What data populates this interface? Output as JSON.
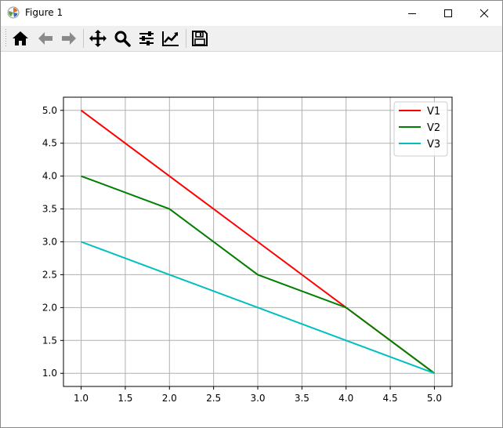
{
  "window": {
    "title": "Figure 1",
    "app_icon": "matplotlib-icon",
    "controls": [
      "minimize-icon",
      "maximize-icon",
      "close-icon"
    ]
  },
  "toolbar": {
    "buttons": [
      {
        "name": "home",
        "icon": "home-icon"
      },
      {
        "name": "back",
        "icon": "arrow-left-icon"
      },
      {
        "name": "forward",
        "icon": "arrow-right-icon"
      },
      {
        "name": "pan",
        "icon": "move-icon"
      },
      {
        "name": "zoom",
        "icon": "magnifier-icon"
      },
      {
        "name": "configure-subplots",
        "icon": "sliders-icon"
      },
      {
        "name": "edit-axis",
        "icon": "line-chart-icon"
      },
      {
        "name": "save",
        "icon": "floppy-disk-icon"
      }
    ]
  },
  "chart_data": {
    "type": "line",
    "x": [
      1,
      2,
      3,
      4,
      5
    ],
    "series": [
      {
        "name": "V1",
        "values": [
          5,
          4,
          3,
          2,
          1
        ],
        "color": "#ff0000"
      },
      {
        "name": "V2",
        "values": [
          4,
          3.5,
          2.5,
          2,
          1
        ],
        "color": "#008000"
      },
      {
        "name": "V3",
        "values": [
          3,
          2.5,
          2,
          1.5,
          1
        ],
        "color": "#00bfbf"
      }
    ],
    "xlim": [
      0.8,
      5.2
    ],
    "ylim": [
      0.8,
      5.2
    ],
    "xticks": [
      "1.0",
      "1.5",
      "2.0",
      "2.5",
      "3.0",
      "3.5",
      "4.0",
      "4.5",
      "5.0"
    ],
    "yticks": [
      "1.0",
      "1.5",
      "2.0",
      "2.5",
      "3.0",
      "3.5",
      "4.0",
      "4.5",
      "5.0"
    ],
    "grid": true,
    "legend_position": "top-right",
    "title": "",
    "xlabel": "",
    "ylabel": ""
  }
}
